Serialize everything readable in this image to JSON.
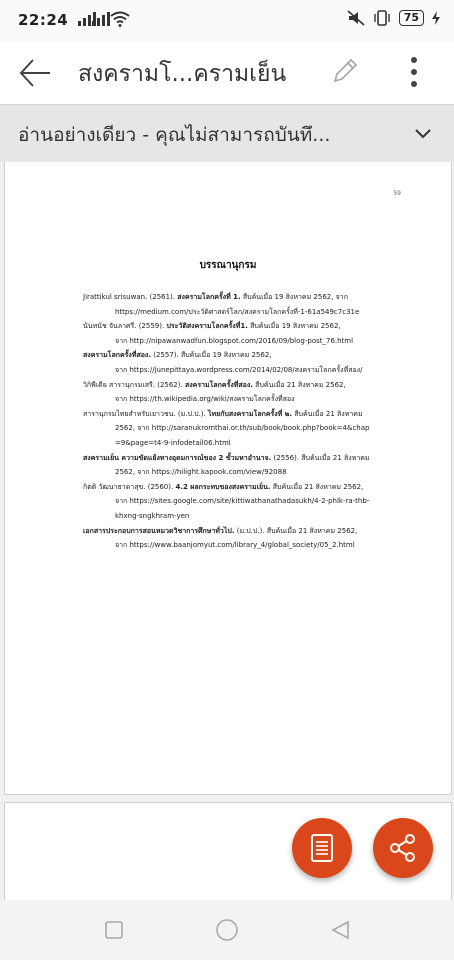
{
  "status": {
    "time": "22:24",
    "battery": "75"
  },
  "appbar": {
    "title": "สงครามโ...ครามเย็น",
    "icons": [
      "back-arrow-icon",
      "pencil-icon",
      "more-vert-icon"
    ]
  },
  "banner": {
    "text": "อ่านอย่างเดียว - คุณไม่สามารถบันทึ...",
    "icon": "chevron-down-icon"
  },
  "document": {
    "page_number": "59",
    "heading": "บรรณานุกรม",
    "refs": [
      {
        "pre": "Jirattikul srisuwan.  (2561).  ",
        "bold": "สงครามโลกครั้งที่ 1.",
        "post": " สืบค้นเมื่อ 19 สิงหาคม 2562,  จาก",
        "line2": "https://medium.com/ประวัติศาสตร์โลก/สงครามโลกครั้งที่-1-61a549c7c31e"
      },
      {
        "pre": "นันทนัช จันลาศรี.  (2559).  ",
        "bold": "ประวัติสงครามโลกครั้งที่1.",
        "post": " สืบค้นเมื่อ 19 สิงหาคม 2562,",
        "line2": "จาก http://nipawanwadfun.blogspot.com/2016/09/blog-post_76.html"
      },
      {
        "pre": "",
        "bold": "สงครามโลกครั้งที่สอง.",
        "post": "  (2557). สืบค้นเมื่อ 19 สิงหาคม 2562,",
        "line2": "จาก https://junepittaya.wordpress.com/2014/02/08/สงครามโลกครั้งที่สอง/"
      },
      {
        "pre": "วิกิพีเดีย สารานุกรมเสรี.  (2562).  ",
        "bold": "สงครามโลกครั้งที่สอง.",
        "post": " สืบค้นเมื่อ 21 สิงหาคม 2562,",
        "line2": "จาก https://th.wikipedia.org/wiki/สงครามโลกครั้งที่สอง"
      },
      {
        "pre": "สารานุกรมไทยสำหรับเยาวชน.  (ม.ป.ป.).  ",
        "bold": "ไทยกับสงครามโลกครั้งที่ ๒.",
        "post": " สืบค้นเมื่อ 21 สิงหาคม",
        "line2": "2562,  จาก http://saranukromthai.or.th/sub/book/book.php?book=4&chap",
        "line3": "=9&page=t4-9-infodetail06.html"
      },
      {
        "pre": "",
        "bold": "สงครามเย็น ความขัดแย้งทางอุดมการณ์ของ 2 ขั้วมหาอำนาจ.",
        "post": "  (2556). สืบค้นเมื่อ 21 สิงหาคม",
        "line2": "2562,  จาก https://hilight.kapook.com/view/92088"
      },
      {
        "pre": "กิตติ วัฒนาธาดาสุข.  (2560).  ",
        "bold": "4.2 ผลกระทบของสงครามเย็น.",
        "post": " สืบค้นเมื่อ 21 สิงหาคม 2562,",
        "line2": "จาก https://sites.google.com/site/kittiwathanathadasukh/4-2-phlk-ra-thb-",
        "line3": "khxng-sngkhram-yen"
      },
      {
        "pre": "",
        "bold": "เอกสารประกอบการสอนหมวดวิชาการศึกษาทั่วไป.",
        "post": "  (ม.ป.ป.). สืบค้นเมื่อ 21 สิงหาคม 2562,",
        "line2": "จาก https://www.baanjomyut.com/library_4/global_society/05_2.html"
      }
    ]
  },
  "fabs": [
    "document-icon",
    "share-icon"
  ],
  "navbar": [
    "recent-apps-icon",
    "home-icon",
    "back-triangle-icon"
  ]
}
